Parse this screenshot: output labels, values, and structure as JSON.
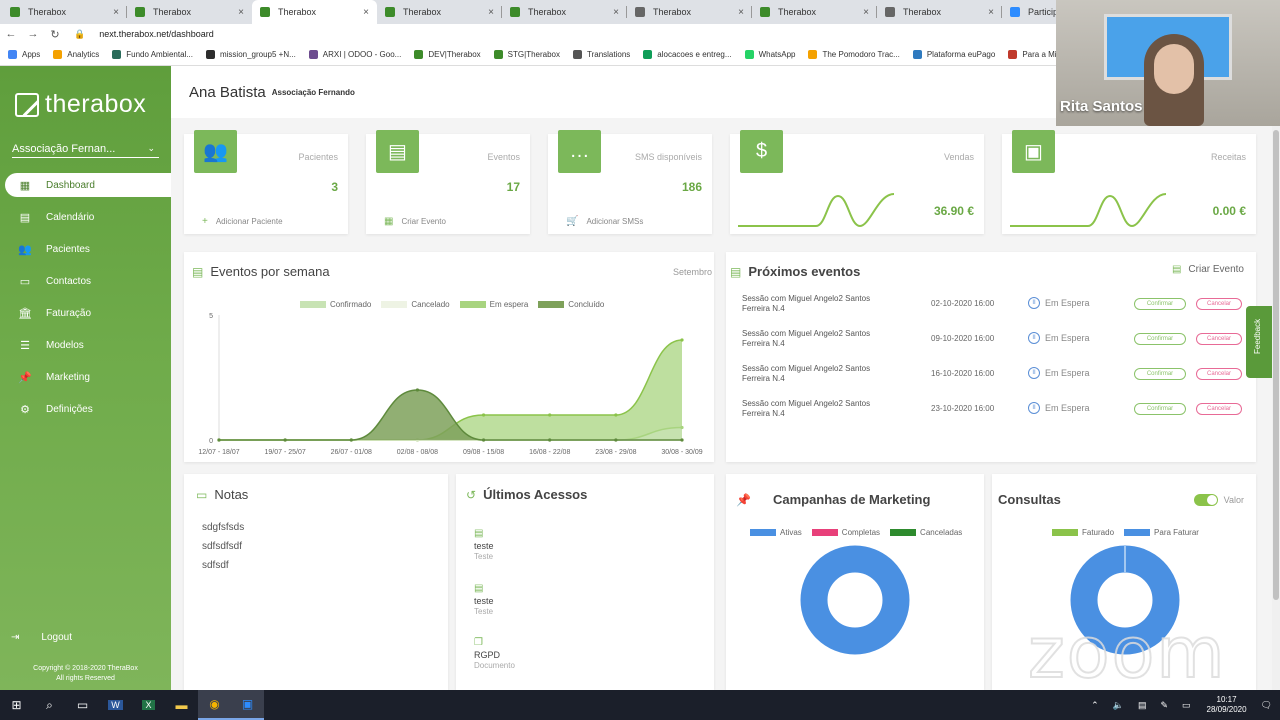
{
  "browser": {
    "tabs": [
      {
        "title": "Therabox",
        "favicon": "#3d8b2a"
      },
      {
        "title": "Therabox",
        "favicon": "#3d8b2a"
      },
      {
        "title": "Therabox",
        "favicon": "#3d8b2a"
      },
      {
        "title": "Therabox",
        "favicon": "#3d8b2a"
      },
      {
        "title": "Therabox",
        "favicon": "#3d8b2a"
      },
      {
        "title": "Therabox",
        "favicon": "#666666"
      },
      {
        "title": "Therabox",
        "favicon": "#3d8b2a"
      },
      {
        "title": "Therabox",
        "favicon": "#666666"
      },
      {
        "title": "Participa",
        "favicon": "#2d8cff"
      }
    ],
    "url": "next.therabox.net/dashboard",
    "bookmarks": [
      {
        "label": "Apps",
        "color": "#4285f4"
      },
      {
        "label": "Analytics",
        "color": "#f4a100"
      },
      {
        "label": "Fundo Ambiental...",
        "color": "#2a6b5a"
      },
      {
        "label": "mission_group5 +N...",
        "color": "#2d2d2d"
      },
      {
        "label": "ARXI | ODOO - Goo...",
        "color": "#6d4c8f"
      },
      {
        "label": "DEV|Therabox",
        "color": "#3d8b2a"
      },
      {
        "label": "STG|Therabox",
        "color": "#3d8b2a"
      },
      {
        "label": "Translations",
        "color": "#555555"
      },
      {
        "label": "alocacoes e entreg...",
        "color": "#0f9d58"
      },
      {
        "label": "WhatsApp",
        "color": "#25d366"
      },
      {
        "label": "The Pomodoro Trac...",
        "color": "#f4a100"
      },
      {
        "label": "Plataforma euPago",
        "color": "#2f7abf"
      },
      {
        "label": "Para a Min",
        "color": "#c0392b"
      }
    ]
  },
  "sidebar": {
    "logo": "therabox",
    "org": "Associação Fernan...",
    "items": [
      {
        "label": "Dashboard",
        "icon": "dashboard-icon",
        "glyph": "▦",
        "active": true
      },
      {
        "label": "Calendário",
        "icon": "calendar-icon",
        "glyph": "▤",
        "active": false
      },
      {
        "label": "Pacientes",
        "icon": "patients-icon",
        "glyph": "👥",
        "active": false
      },
      {
        "label": "Contactos",
        "icon": "contacts-icon",
        "glyph": "▭",
        "active": false
      },
      {
        "label": "Faturação",
        "icon": "billing-icon",
        "glyph": "🏛",
        "active": false
      },
      {
        "label": "Modelos",
        "icon": "templates-icon",
        "glyph": "☰",
        "active": false
      },
      {
        "label": "Marketing",
        "icon": "marketing-icon",
        "glyph": "📌",
        "active": false
      },
      {
        "label": "Definições",
        "icon": "settings-icon",
        "glyph": "⚙",
        "active": false
      }
    ],
    "logout": "Logout",
    "copyright": [
      "Copyright © 2018-2020 TheraBox",
      "All rights Reserved"
    ]
  },
  "header": {
    "user": "Ana Batista",
    "org": "Associação Fernando"
  },
  "stats": {
    "pacientes": {
      "label": "Pacientes",
      "value": "3",
      "link": "Adicionar Paciente"
    },
    "eventos": {
      "label": "Eventos",
      "value": "17",
      "link": "Criar Evento"
    },
    "sms": {
      "label": "SMS disponíveis",
      "value": "186",
      "link": "Adicionar SMSs"
    },
    "vendas": {
      "label": "Vendas",
      "value": "36.90 €"
    },
    "receitas": {
      "label": "Receitas",
      "value": "0.00 €"
    }
  },
  "eventos_semana": {
    "title": "Eventos por semana",
    "period": "Setembro",
    "legend": [
      "Confirmado",
      "Cancelado",
      "Em espera",
      "Concluído"
    ],
    "colors": {
      "Confirmado": "#c8e3b4",
      "Cancelado": "#eef3e4",
      "Em espera": "#a8d47f",
      "Concluído": "#7ea15a"
    }
  },
  "chart_data": {
    "type": "area",
    "title": "Eventos por semana",
    "categories": [
      "12/07 - 18/07",
      "19/07 - 25/07",
      "26/07 - 01/08",
      "02/08 - 08/08",
      "09/08 - 15/08",
      "16/08 - 22/08",
      "23/08 - 29/08",
      "30/08 - 30/09"
    ],
    "y_ticks": [
      "0",
      "5"
    ],
    "ylim": [
      0,
      5
    ],
    "series": [
      {
        "name": "Confirmado",
        "values": [
          0,
          0,
          0,
          0,
          0,
          0,
          0,
          0.5
        ]
      },
      {
        "name": "Cancelado",
        "values": [
          0,
          0,
          0,
          0,
          0,
          0,
          0,
          0
        ]
      },
      {
        "name": "Em espera",
        "values": [
          0,
          0,
          0,
          0,
          1,
          1,
          1,
          4
        ]
      },
      {
        "name": "Concluído",
        "values": [
          0,
          0,
          0,
          2,
          0,
          0,
          0,
          0
        ]
      }
    ]
  },
  "proximos": {
    "title": "Próximos eventos",
    "create": "Criar Evento",
    "rows": [
      {
        "text": "Sessão com Miguel Angelo2 Santos Ferreira N.4",
        "date": "02-10-2020 16:00",
        "status": "Em Espera",
        "confirm": "Confirmar",
        "cancel": "Cancelar"
      },
      {
        "text": "Sessão com Miguel Angelo2 Santos Ferreira N.4",
        "date": "09-10-2020 16:00",
        "status": "Em Espera",
        "confirm": "Confirmar",
        "cancel": "Cancelar"
      },
      {
        "text": "Sessão com Miguel Angelo2 Santos Ferreira N.4",
        "date": "16-10-2020 16:00",
        "status": "Em Espera",
        "confirm": "Confirmar",
        "cancel": "Cancelar"
      },
      {
        "text": "Sessão com Miguel Angelo2 Santos Ferreira N.4",
        "date": "23-10-2020 16:00",
        "status": "Em Espera",
        "confirm": "Confirmar",
        "cancel": "Cancelar"
      }
    ]
  },
  "notas": {
    "title": "Notas",
    "items": [
      "sdgfsfsds",
      "sdfsdfsdf",
      "sdfsdf"
    ]
  },
  "acessos": {
    "title": "Últimos Acessos",
    "items": [
      {
        "name": "teste",
        "type": "Teste",
        "icon": "test-icon"
      },
      {
        "name": "teste",
        "type": "Teste",
        "icon": "test-icon"
      },
      {
        "name": "RGPD",
        "type": "Documento",
        "icon": "document-icon"
      }
    ]
  },
  "campanhas": {
    "title": "Campanhas de Marketing",
    "legend": [
      {
        "label": "Ativas",
        "color": "#4a90e2"
      },
      {
        "label": "Completas",
        "color": "#e8407a"
      },
      {
        "label": "Canceladas",
        "color": "#2e8b2e"
      }
    ],
    "donut_color": "#4a90e2"
  },
  "consultas": {
    "title": "Consultas",
    "toggle_label": "Valor",
    "legend": [
      {
        "label": "Faturado",
        "color": "#8bc34a"
      },
      {
        "label": "Para Faturar",
        "color": "#4a90e2"
      }
    ],
    "donut_color": "#4a90e2"
  },
  "webcam": {
    "name": "Rita Santos"
  },
  "feedback": "Feedback",
  "zoom": "zoom",
  "taskbar": {
    "time": "10:17",
    "date": "28/09/2020"
  }
}
